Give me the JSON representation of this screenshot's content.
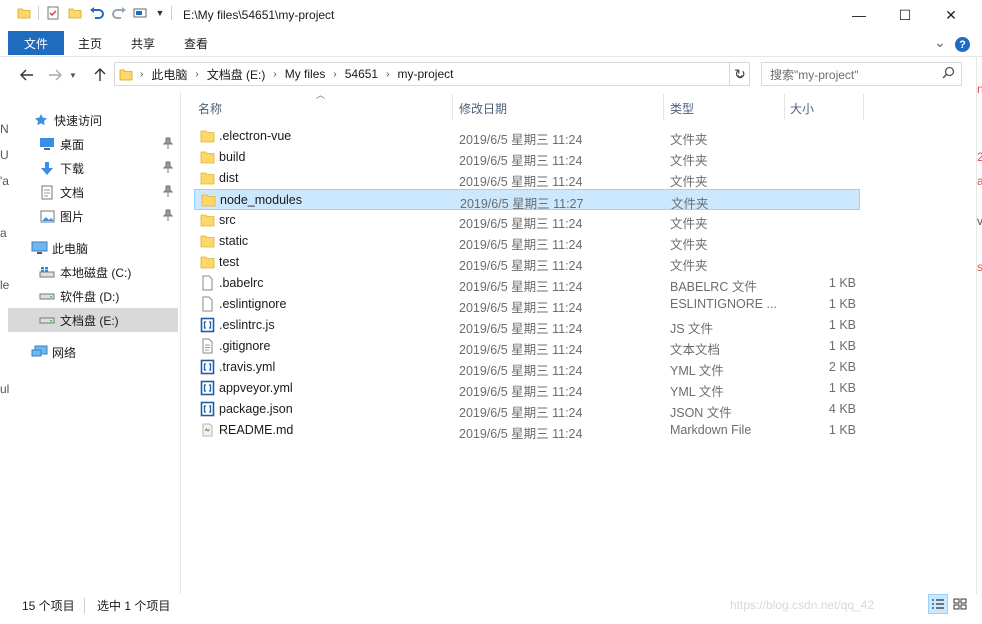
{
  "window": {
    "title": "E:\\My files\\54651\\my-project",
    "minimize": "—",
    "maximize": "☐",
    "close": "✕"
  },
  "ribbon": {
    "file": "文件",
    "tabs": [
      "主页",
      "共享",
      "查看"
    ],
    "expand": "⌄",
    "help": "?"
  },
  "address": {
    "segments": [
      "此电脑",
      "文档盘 (E:)",
      "My files",
      "54651",
      "my-project"
    ],
    "refresh": "↻"
  },
  "search": {
    "placeholder": "搜索\"my-project\""
  },
  "nav": {
    "quick_access": "快速访问",
    "desktop": "桌面",
    "downloads": "下载",
    "documents": "文档",
    "pictures": "图片",
    "this_pc": "此电脑",
    "drive_c": "本地磁盘 (C:)",
    "drive_d": "软件盘 (D:)",
    "drive_e": "文档盘 (E:)",
    "network": "网络"
  },
  "columns": {
    "name": "名称",
    "date": "修改日期",
    "type": "类型",
    "size": "大小"
  },
  "files": [
    {
      "name": ".electron-vue",
      "date": "2019/6/5 星期三 11:24",
      "type": "文件夹",
      "size": "",
      "icon": "folder"
    },
    {
      "name": "build",
      "date": "2019/6/5 星期三 11:24",
      "type": "文件夹",
      "size": "",
      "icon": "folder"
    },
    {
      "name": "dist",
      "date": "2019/6/5 星期三 11:24",
      "type": "文件夹",
      "size": "",
      "icon": "folder"
    },
    {
      "name": "node_modules",
      "date": "2019/6/5 星期三 11:27",
      "type": "文件夹",
      "size": "",
      "icon": "folder",
      "selected": true
    },
    {
      "name": "src",
      "date": "2019/6/5 星期三 11:24",
      "type": "文件夹",
      "size": "",
      "icon": "folder"
    },
    {
      "name": "static",
      "date": "2019/6/5 星期三 11:24",
      "type": "文件夹",
      "size": "",
      "icon": "folder"
    },
    {
      "name": "test",
      "date": "2019/6/5 星期三 11:24",
      "type": "文件夹",
      "size": "",
      "icon": "folder"
    },
    {
      "name": ".babelrc",
      "date": "2019/6/5 星期三 11:24",
      "type": "BABELRC 文件",
      "size": "1 KB",
      "icon": "file"
    },
    {
      "name": ".eslintignore",
      "date": "2019/6/5 星期三 11:24",
      "type": "ESLINTIGNORE ...",
      "size": "1 KB",
      "icon": "file"
    },
    {
      "name": ".eslintrc.js",
      "date": "2019/6/5 星期三 11:24",
      "type": "JS 文件",
      "size": "1 KB",
      "icon": "code"
    },
    {
      "name": ".gitignore",
      "date": "2019/6/5 星期三 11:24",
      "type": "文本文档",
      "size": "1 KB",
      "icon": "text"
    },
    {
      "name": ".travis.yml",
      "date": "2019/6/5 星期三 11:24",
      "type": "YML 文件",
      "size": "2 KB",
      "icon": "code"
    },
    {
      "name": "appveyor.yml",
      "date": "2019/6/5 星期三 11:24",
      "type": "YML 文件",
      "size": "1 KB",
      "icon": "code"
    },
    {
      "name": "package.json",
      "date": "2019/6/5 星期三 11:24",
      "type": "JSON 文件",
      "size": "4 KB",
      "icon": "code"
    },
    {
      "name": "README.md",
      "date": "2019/6/5 星期三 11:24",
      "type": "Markdown File",
      "size": "1 KB",
      "icon": "md"
    }
  ],
  "status": {
    "count": "15 个项目",
    "selection": "选中 1 个项目"
  },
  "watermark": "https://blog.csdn.net/qq_42"
}
